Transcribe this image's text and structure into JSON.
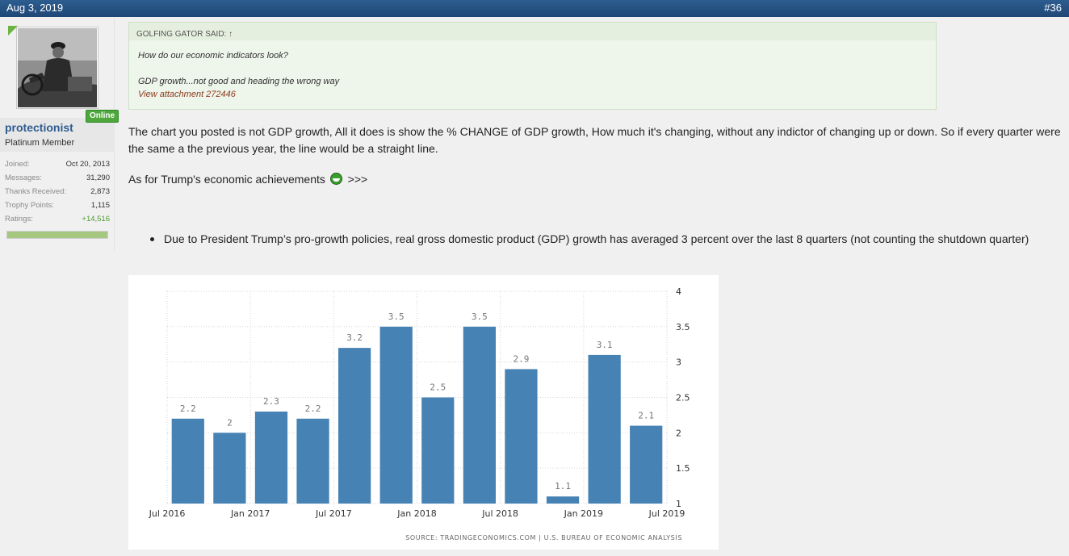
{
  "post": {
    "date": "Aug 3, 2019",
    "number": "#36"
  },
  "user": {
    "name": "protectionist",
    "title": "Platinum Member",
    "online_label": "Online",
    "stats": [
      {
        "label": "Joined:",
        "value": "Oct 20, 2013"
      },
      {
        "label": "Messages:",
        "value": "31,290"
      },
      {
        "label": "Thanks Received:",
        "value": "2,873"
      },
      {
        "label": "Trophy Points:",
        "value": "1,115"
      },
      {
        "label": "Ratings:",
        "value": "+14,516"
      }
    ]
  },
  "quote": {
    "author": "GOLFING GATOR SAID:",
    "arrow": "↑",
    "line1": "How do our economic indicators look?",
    "line2": "GDP growth...not good and heading the wrong way",
    "link": "View attachment 272446"
  },
  "message": {
    "p1": "The chart you posted is not GDP growth, All it does is show the % CHANGE of GDP growth, How much it's changing, without any indictor of changing up or down. So if every quarter were the same a the previous year, the line would be a straight line.",
    "p2_before": "As for Trump's economic achievements",
    "p2_after": ">>>",
    "bullet": "Due to President Trump’s pro-growth policies, real gross domestic product (GDP) growth has averaged 3 percent over the last 8 quarters (not counting the shutdown quarter)"
  },
  "chart_data": {
    "type": "bar",
    "title": "",
    "xlabel": "",
    "ylabel": "",
    "color": "#4682b4",
    "values": [
      2.2,
      2,
      2.3,
      2.2,
      3.2,
      3.5,
      2.5,
      3.5,
      2.9,
      1.1,
      3.1,
      2.1
    ],
    "value_labels": [
      "2.2",
      "2",
      "2.3",
      "2.2",
      "3.2",
      "3.5",
      "2.5",
      "3.5",
      "2.9",
      "1.1",
      "3.1",
      "2.1"
    ],
    "x_ticks": [
      "Jul 2016",
      "Jan 2017",
      "Jul 2017",
      "Jan 2018",
      "Jul 2018",
      "Jan 2019",
      "Jul 2019"
    ],
    "y_ticks": [
      "1",
      "1.5",
      "2",
      "2.5",
      "3",
      "3.5",
      "4"
    ],
    "ylim": [
      1,
      4
    ],
    "y_axis_side": "right",
    "grid": true,
    "source": "SOURCE: TRADINGECONOMICS.COM | U.S. BUREAU OF ECONOMIC ANALYSIS"
  }
}
